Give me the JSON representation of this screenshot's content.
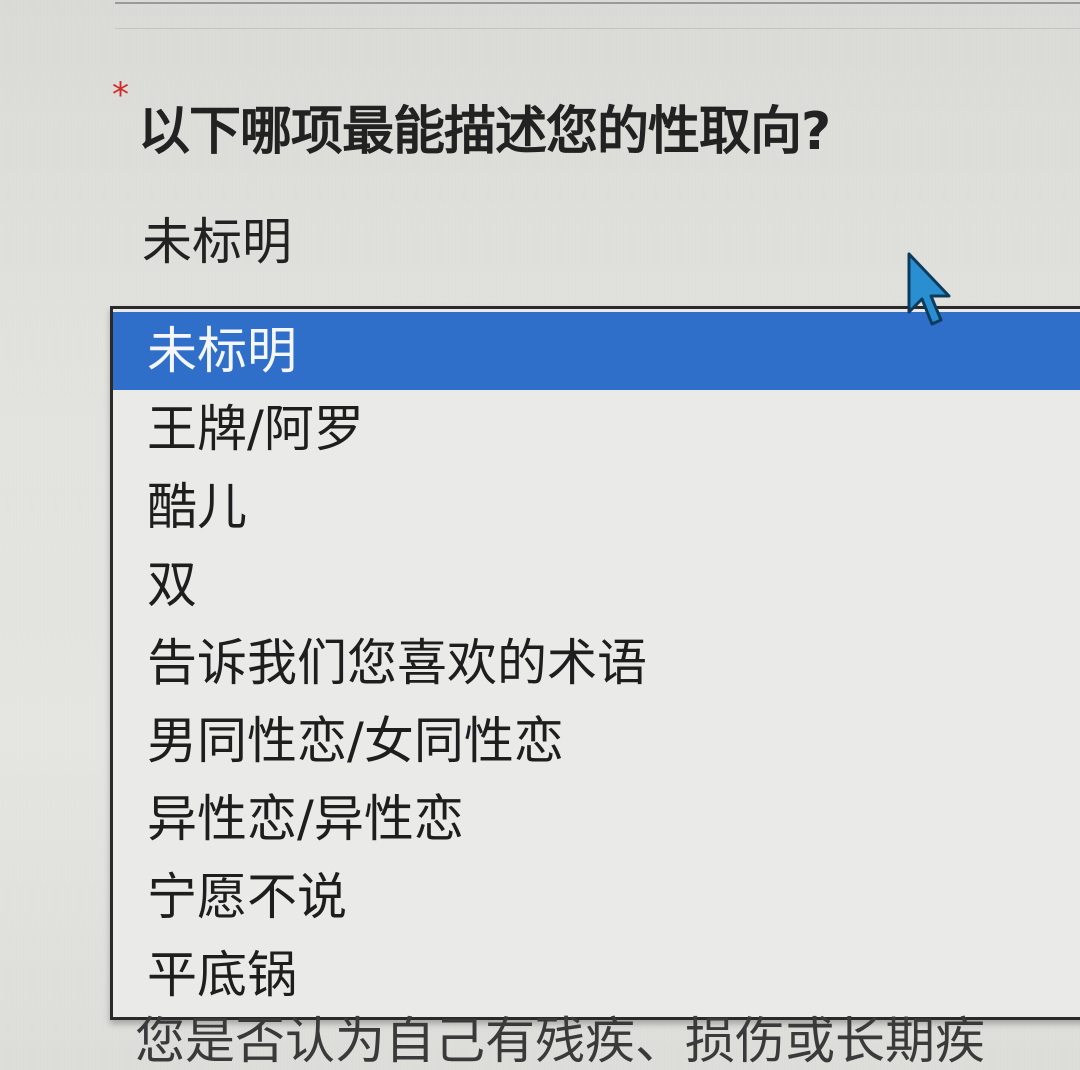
{
  "question": {
    "required_marker": "*",
    "text": "以下哪项最能描述您的性取向?"
  },
  "select": {
    "current_value": "未标明",
    "selected_index": 0,
    "options": [
      "未标明",
      "王牌/阿罗",
      "酷儿",
      "双",
      "告诉我们您喜欢的术语",
      "男同性恋/女同性恋",
      "异性恋/异性恋",
      "宁愿不说",
      "平底锅"
    ]
  },
  "footer": {
    "partial_text": "您是否认为自己有残疾、损伤或长期疾"
  },
  "colors": {
    "selection": "#2f6fc9",
    "required": "#d22a2a",
    "cursor": "#2a8fd0"
  },
  "icons": {
    "cursor": "mouse-pointer-icon"
  }
}
